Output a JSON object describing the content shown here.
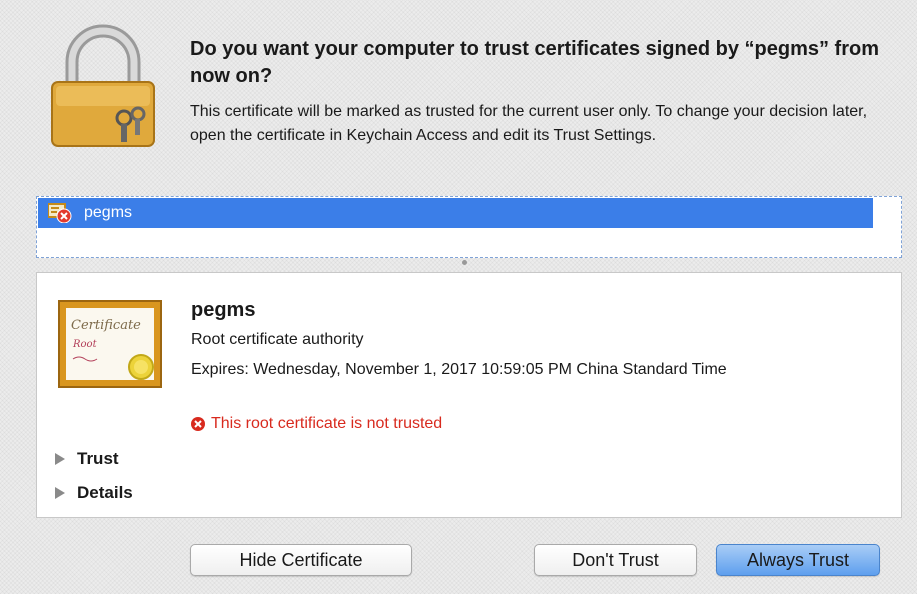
{
  "dialog": {
    "title": "Do you want your computer to trust certificates signed by “pegms” from now on?",
    "message": "This certificate will be marked as trusted for the current user only. To change your decision later, open the certificate in Keychain Access and edit its Trust Settings.",
    "icon": "padlock-with-keys-icon"
  },
  "certificate_list": {
    "items": [
      {
        "label": "pegms",
        "icon": "certificate-error-icon",
        "selected": true
      }
    ],
    "selection_color": "#3b7ee8"
  },
  "details": {
    "name": "pegms",
    "kind": "Root certificate authority",
    "expires": "Expires: Wednesday, November 1, 2017 10:59:05 PM China Standard Time",
    "status": "This root certificate is not trusted",
    "status_color": "#d82a1e",
    "icon": "certificate-icon",
    "certificate_image": {
      "title": "Certificate",
      "subtitle": "Root"
    },
    "sections": [
      {
        "label": "Trust",
        "expanded": false
      },
      {
        "label": "Details",
        "expanded": false
      }
    ]
  },
  "buttons": {
    "hide_certificate": "Hide Certificate",
    "dont_trust": "Don't Trust",
    "always_trust": "Always Trust"
  }
}
